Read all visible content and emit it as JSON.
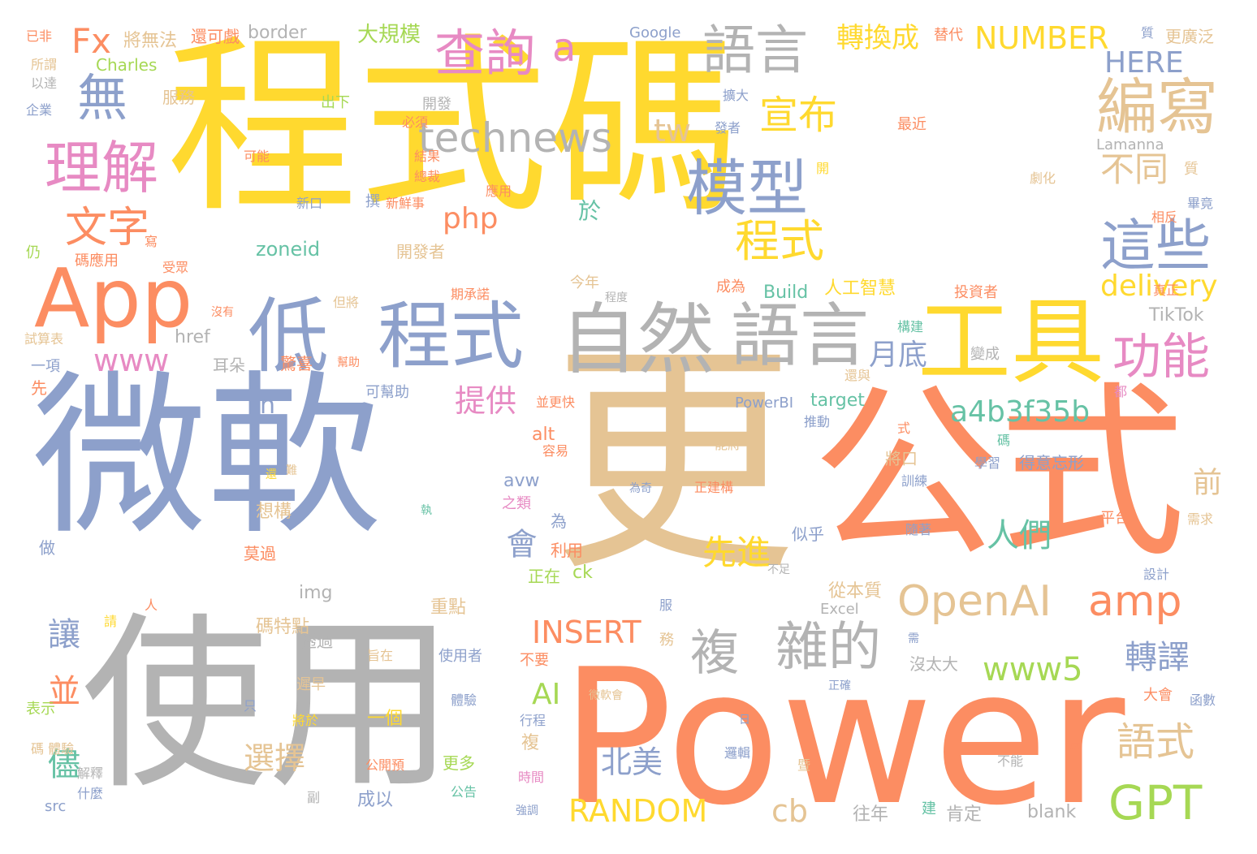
{
  "palette": {
    "yellow": "#FFD92F",
    "slate": "#8DA0CB",
    "tan": "#E5C494",
    "orange": "#FC8D62",
    "gray": "#B3B3B3",
    "green": "#66C2A5",
    "pink": "#E78AC3",
    "lime": "#A6D854"
  },
  "words": [
    {
      "text": "程式碼",
      "color": "yellow"
    },
    {
      "text": "微軟",
      "color": "slate"
    },
    {
      "text": "更",
      "color": "tan"
    },
    {
      "text": "公式",
      "color": "orange"
    },
    {
      "text": "使用",
      "color": "gray"
    },
    {
      "text": "Power",
      "color": "orange"
    },
    {
      "text": "App",
      "color": "orange"
    },
    {
      "text": "低",
      "color": "slate"
    },
    {
      "text": "程式",
      "color": "slate"
    },
    {
      "text": "自然",
      "color": "gray"
    },
    {
      "text": "語言",
      "color": "gray"
    },
    {
      "text": "工具",
      "color": "yellow"
    },
    {
      "text": "模型",
      "color": "slate"
    },
    {
      "text": "理解",
      "color": "pink"
    },
    {
      "text": "文字",
      "color": "orange"
    },
    {
      "text": "查詢",
      "color": "pink"
    },
    {
      "text": "語言",
      "color": "gray"
    },
    {
      "text": "編寫",
      "color": "tan"
    },
    {
      "text": "這些",
      "color": "slate"
    },
    {
      "text": "功能",
      "color": "pink"
    },
    {
      "text": "technews",
      "color": "gray"
    },
    {
      "text": "複",
      "color": "gray"
    },
    {
      "text": "雜的",
      "color": "gray"
    },
    {
      "text": "OpenAI",
      "color": "tan"
    },
    {
      "text": "amp",
      "color": "orange"
    },
    {
      "text": "GPT",
      "color": "lime"
    },
    {
      "text": "宣布",
      "color": "yellow"
    },
    {
      "text": "不同",
      "color": "tan"
    },
    {
      "text": "程式",
      "color": "yellow"
    },
    {
      "text": "無",
      "color": "slate"
    },
    {
      "text": "Fx",
      "color": "orange"
    },
    {
      "text": "a",
      "color": "pink"
    },
    {
      "text": "NUMBER",
      "color": "yellow"
    },
    {
      "text": "HERE",
      "color": "slate"
    },
    {
      "text": "轉換成",
      "color": "yellow"
    },
    {
      "text": "大規模",
      "color": "lime"
    },
    {
      "text": "border",
      "color": "gray"
    },
    {
      "text": "Google",
      "color": "slate"
    },
    {
      "text": "tw",
      "color": "tan"
    },
    {
      "text": "php",
      "color": "orange"
    },
    {
      "text": "delivery",
      "color": "yellow"
    },
    {
      "text": "www",
      "color": "pink"
    },
    {
      "text": "月底",
      "color": "slate"
    },
    {
      "text": "a4b3f35b",
      "color": "green"
    },
    {
      "text": "www5",
      "color": "lime"
    },
    {
      "text": "轉譯",
      "color": "slate"
    },
    {
      "text": "語式",
      "color": "tan"
    },
    {
      "text": "INSERT",
      "color": "orange"
    },
    {
      "text": "RANDOM",
      "color": "yellow"
    },
    {
      "text": "cb",
      "color": "tan"
    },
    {
      "text": "AI",
      "color": "lime"
    },
    {
      "text": "北美",
      "color": "slate"
    },
    {
      "text": "選擇",
      "color": "tan"
    },
    {
      "text": "提供",
      "color": "pink"
    },
    {
      "text": "會",
      "color": "slate"
    },
    {
      "text": "先進",
      "color": "yellow"
    },
    {
      "text": "人們",
      "color": "green"
    },
    {
      "text": "讓",
      "color": "slate"
    },
    {
      "text": "並",
      "color": "orange"
    },
    {
      "text": "儘",
      "color": "green"
    },
    {
      "text": "n",
      "color": "slate"
    },
    {
      "text": "於",
      "color": "green"
    },
    {
      "text": "前",
      "color": "tan"
    },
    {
      "text": "zoneid",
      "color": "green"
    },
    {
      "text": "Charles",
      "color": "lime"
    },
    {
      "text": "將無法",
      "color": "tan"
    },
    {
      "text": "還可戲",
      "color": "orange"
    },
    {
      "text": "替代",
      "color": "orange"
    },
    {
      "text": "更廣泛",
      "color": "tan"
    },
    {
      "text": "Lamanna",
      "color": "gray"
    },
    {
      "text": "TikTok",
      "color": "gray"
    },
    {
      "text": "target",
      "color": "green"
    },
    {
      "text": "PowerBI",
      "color": "slate"
    },
    {
      "text": "Build",
      "color": "green"
    },
    {
      "text": "人工智慧",
      "color": "yellow"
    },
    {
      "text": "投資者",
      "color": "orange"
    },
    {
      "text": "img",
      "color": "gray"
    },
    {
      "text": "Excel",
      "color": "gray"
    },
    {
      "text": "從本質",
      "color": "tan"
    },
    {
      "text": "href",
      "color": "gray"
    },
    {
      "text": "alt",
      "color": "orange"
    },
    {
      "text": "avw",
      "color": "slate"
    },
    {
      "text": "src",
      "color": "slate"
    },
    {
      "text": "blank",
      "color": "gray"
    },
    {
      "text": "ck",
      "color": "lime"
    },
    {
      "text": "開發者",
      "color": "tan"
    },
    {
      "text": "開發",
      "color": "gray"
    },
    {
      "text": "得意忘形",
      "color": "slate"
    },
    {
      "text": "平台",
      "color": "orange"
    },
    {
      "text": "正在",
      "color": "lime"
    },
    {
      "text": "重點",
      "color": "tan"
    },
    {
      "text": "一個",
      "color": "yellow"
    },
    {
      "text": "透過",
      "color": "gray"
    },
    {
      "text": "沒太大",
      "color": "gray"
    },
    {
      "text": "更多",
      "color": "lime"
    },
    {
      "text": "公告",
      "color": "green"
    },
    {
      "text": "成以",
      "color": "slate"
    },
    {
      "text": "往年",
      "color": "gray"
    },
    {
      "text": "肯定",
      "color": "gray"
    },
    {
      "text": "碼特點",
      "color": "tan"
    },
    {
      "text": "莫過",
      "color": "orange"
    },
    {
      "text": "利用",
      "color": "orange"
    },
    {
      "text": "想構",
      "color": "tan"
    },
    {
      "text": "耳朵",
      "color": "gray"
    },
    {
      "text": "驚喜",
      "color": "orange"
    },
    {
      "text": "可幫助",
      "color": "slate"
    },
    {
      "text": "已非",
      "color": "orange"
    },
    {
      "text": "所謂",
      "color": "tan"
    },
    {
      "text": "以達",
      "color": "gray"
    },
    {
      "text": "企業",
      "color": "slate"
    },
    {
      "text": "服務",
      "color": "tan"
    },
    {
      "text": "出下",
      "color": "lime"
    },
    {
      "text": "必須",
      "color": "orange"
    },
    {
      "text": "擴大",
      "color": "slate"
    },
    {
      "text": "發者",
      "color": "slate"
    },
    {
      "text": "最近",
      "color": "orange"
    },
    {
      "text": "可能",
      "color": "orange"
    },
    {
      "text": "結果",
      "color": "orange"
    },
    {
      "text": "總裁",
      "color": "orange"
    },
    {
      "text": "應用",
      "color": "orange"
    },
    {
      "text": "新口",
      "color": "slate"
    },
    {
      "text": "撰",
      "color": "slate"
    },
    {
      "text": "新鮮事",
      "color": "orange"
    },
    {
      "text": "劇化",
      "color": "tan"
    },
    {
      "text": "相反",
      "color": "orange"
    },
    {
      "text": "畢竟",
      "color": "slate"
    },
    {
      "text": "期承諾",
      "color": "orange"
    },
    {
      "text": "今年",
      "color": "tan"
    },
    {
      "text": "程度",
      "color": "gray"
    },
    {
      "text": "成為",
      "color": "orange"
    },
    {
      "text": "但將",
      "color": "tan"
    },
    {
      "text": "試算表",
      "color": "tan"
    },
    {
      "text": "一項",
      "color": "slate"
    },
    {
      "text": "碼應用",
      "color": "orange"
    },
    {
      "text": "受眾",
      "color": "orange"
    },
    {
      "text": "幫助",
      "color": "orange"
    },
    {
      "text": "變成",
      "color": "gray"
    },
    {
      "text": "構建",
      "color": "green"
    },
    {
      "text": "還與",
      "color": "tan"
    },
    {
      "text": "推動",
      "color": "slate"
    },
    {
      "text": "學習",
      "color": "slate"
    },
    {
      "text": "訓練",
      "color": "slate"
    },
    {
      "text": "正建構",
      "color": "orange"
    },
    {
      "text": "為奇",
      "color": "slate"
    },
    {
      "text": "能將",
      "color": "tan"
    },
    {
      "text": "並更快",
      "color": "orange"
    },
    {
      "text": "之類",
      "color": "pink"
    },
    {
      "text": "容易",
      "color": "orange"
    },
    {
      "text": "為",
      "color": "slate"
    },
    {
      "text": "將口",
      "color": "tan"
    },
    {
      "text": "似乎",
      "color": "slate"
    },
    {
      "text": "不足",
      "color": "gray"
    },
    {
      "text": "隨著",
      "color": "slate"
    },
    {
      "text": "需求",
      "color": "tan"
    },
    {
      "text": "設計",
      "color": "slate"
    },
    {
      "text": "大會",
      "color": "orange"
    },
    {
      "text": "函數",
      "color": "slate"
    },
    {
      "text": "旨在",
      "color": "tan"
    },
    {
      "text": "使用者",
      "color": "slate"
    },
    {
      "text": "不要",
      "color": "orange"
    },
    {
      "text": "微軟會",
      "color": "tan"
    },
    {
      "text": "體驗",
      "color": "slate"
    },
    {
      "text": "行程",
      "color": "slate"
    },
    {
      "text": "遲早",
      "color": "tan"
    },
    {
      "text": "將於",
      "color": "yellow"
    },
    {
      "text": "公開預",
      "color": "orange"
    },
    {
      "text": "時間",
      "color": "pink"
    },
    {
      "text": "強調",
      "color": "slate"
    },
    {
      "text": "什麼",
      "color": "slate"
    },
    {
      "text": "解釋",
      "color": "gray"
    },
    {
      "text": "表示",
      "color": "lime"
    },
    {
      "text": "碼 體驗",
      "color": "tan"
    },
    {
      "text": "不能",
      "color": "gray"
    },
    {
      "text": "邏輯",
      "color": "slate"
    },
    {
      "text": "正確",
      "color": "slate"
    },
    {
      "text": "沒有",
      "color": "orange"
    },
    {
      "text": "先",
      "color": "orange"
    },
    {
      "text": "仍",
      "color": "lime"
    },
    {
      "text": "做",
      "color": "slate"
    },
    {
      "text": "請",
      "color": "yellow"
    },
    {
      "text": "人",
      "color": "orange"
    },
    {
      "text": "只",
      "color": "slate"
    },
    {
      "text": "副",
      "color": "gray"
    },
    {
      "text": "日",
      "color": "slate"
    },
    {
      "text": "服",
      "color": "slate"
    },
    {
      "text": "務",
      "color": "tan"
    },
    {
      "text": "需",
      "color": "slate"
    },
    {
      "text": "複",
      "color": "tan"
    },
    {
      "text": "建",
      "color": "green"
    },
    {
      "text": "長",
      "color": "orange"
    },
    {
      "text": "暨",
      "color": "tan"
    },
    {
      "text": "執",
      "color": "green"
    },
    {
      "text": "式",
      "color": "orange"
    },
    {
      "text": "碼",
      "color": "green"
    },
    {
      "text": "都",
      "color": "pink"
    },
    {
      "text": "還",
      "color": "yellow"
    },
    {
      "text": "難",
      "color": "tan"
    },
    {
      "text": "真正",
      "color": "orange"
    },
    {
      "text": "寫",
      "color": "orange"
    },
    {
      "text": "質",
      "color": "tan"
    },
    {
      "text": "開",
      "color": "yellow"
    },
    {
      "text": "質",
      "color": "slate"
    }
  ]
}
